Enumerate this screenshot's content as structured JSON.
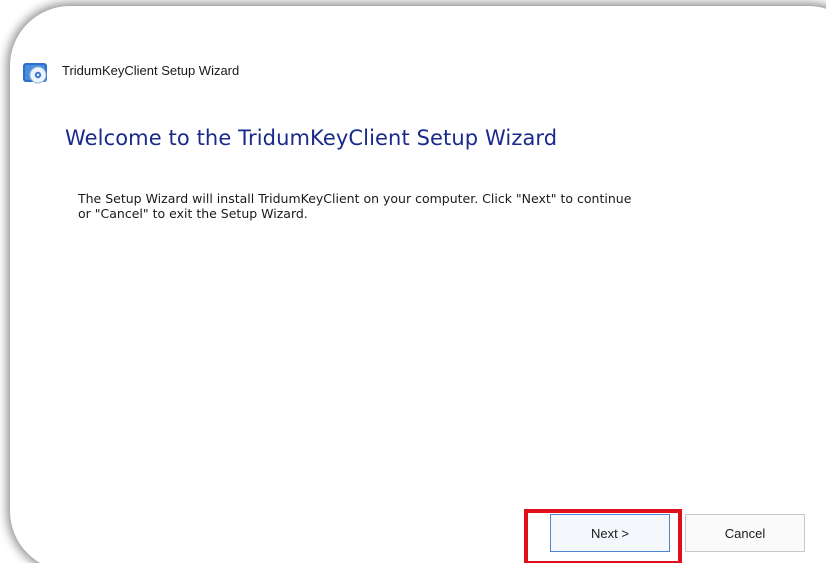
{
  "window": {
    "title": "TridumKeyClient Setup Wizard",
    "icon": "setup-disc-icon"
  },
  "content": {
    "heading": "Welcome to the TridumKeyClient Setup Wizard",
    "body": "The Setup Wizard will install TridumKeyClient on your computer.  Click \"Next\" to continue\nor \"Cancel\" to exit the Setup Wizard."
  },
  "buttons": {
    "next_label": "Next >",
    "cancel_label": "Cancel"
  },
  "colors": {
    "heading": "#1a2a8c",
    "highlight": "#e0101a",
    "next_border": "#4a86d8"
  }
}
